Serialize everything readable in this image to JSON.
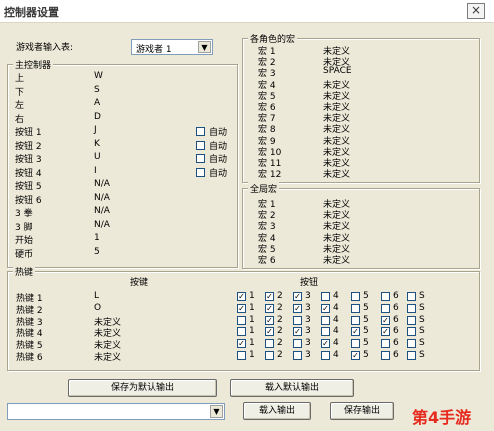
{
  "window": {
    "title": "控制器设置",
    "close_glyph": "×"
  },
  "player": {
    "label": "游戏者输入表:",
    "selected": "游戏者 1"
  },
  "main_controller": {
    "legend": "主控制器",
    "rows": [
      {
        "label": "上",
        "key": "W"
      },
      {
        "label": "下",
        "key": "S"
      },
      {
        "label": "左",
        "key": "A"
      },
      {
        "label": "右",
        "key": "D"
      },
      {
        "label": "按钮 1",
        "key": "J",
        "auto": "自动"
      },
      {
        "label": "按钮 2",
        "key": "K",
        "auto": "自动"
      },
      {
        "label": "按钮 3",
        "key": "U",
        "auto": "自动"
      },
      {
        "label": "按钮 4",
        "key": "I",
        "auto": "自动"
      },
      {
        "label": "按钮 5",
        "key": "N/A"
      },
      {
        "label": "按钮 6",
        "key": "N/A"
      },
      {
        "label": "3 拳",
        "key": "N/A"
      },
      {
        "label": "3 脚",
        "key": "N/A"
      },
      {
        "label": "开始",
        "key": "1"
      },
      {
        "label": "硬币",
        "key": "5"
      }
    ]
  },
  "char_macros": {
    "legend": "各角色的宏",
    "rows": [
      {
        "label": "宏 1",
        "value": "未定义"
      },
      {
        "label": "宏 2",
        "value": "未定义"
      },
      {
        "label": "宏 3",
        "value": "SPACE"
      },
      {
        "label": "宏 4",
        "value": "未定义"
      },
      {
        "label": "宏 5",
        "value": "未定义"
      },
      {
        "label": "宏 6",
        "value": "未定义"
      },
      {
        "label": "宏 7",
        "value": "未定义"
      },
      {
        "label": "宏 8",
        "value": "未定义"
      },
      {
        "label": "宏 9",
        "value": "未定义"
      },
      {
        "label": "宏 10",
        "value": "未定义"
      },
      {
        "label": "宏 11",
        "value": "未定义"
      },
      {
        "label": "宏 12",
        "value": "未定义"
      }
    ]
  },
  "global_macros": {
    "legend": "全局宏",
    "rows": [
      {
        "label": "宏 1",
        "value": "未定义"
      },
      {
        "label": "宏 2",
        "value": "未定义"
      },
      {
        "label": "宏 3",
        "value": "未定义"
      },
      {
        "label": "宏 4",
        "value": "未定义"
      },
      {
        "label": "宏 5",
        "value": "未定义"
      },
      {
        "label": "宏 6",
        "value": "未定义"
      }
    ]
  },
  "hotkeys": {
    "legend": "热键",
    "col_key": "按键",
    "col_buttons": "按钮",
    "button_labels": [
      "1",
      "2",
      "3",
      "4",
      "5",
      "6",
      "S"
    ],
    "rows": [
      {
        "label": "热键 1",
        "key": "L",
        "checks": [
          true,
          true,
          true,
          false,
          false,
          false,
          false
        ]
      },
      {
        "label": "热键 2",
        "key": "O",
        "checks": [
          true,
          true,
          true,
          true,
          false,
          false,
          false
        ]
      },
      {
        "label": "热键 3",
        "key": "未定义",
        "checks": [
          false,
          true,
          false,
          false,
          false,
          true,
          false
        ]
      },
      {
        "label": "热键 4",
        "key": "未定义",
        "checks": [
          false,
          true,
          true,
          false,
          true,
          true,
          false
        ]
      },
      {
        "label": "热键 5",
        "key": "未定义",
        "checks": [
          true,
          false,
          false,
          true,
          false,
          false,
          false
        ]
      },
      {
        "label": "热键 6",
        "key": "未定义",
        "checks": [
          false,
          false,
          false,
          false,
          true,
          false,
          false
        ]
      }
    ]
  },
  "actions": {
    "save_default": "保存为默认输出",
    "load_default": "载入默认输出",
    "load_output": "载入输出",
    "save_output": "保存输出",
    "profile_value": "",
    "check_glyph": "✓",
    "dropdown_glyph": "▼"
  },
  "watermark": "第4手游"
}
